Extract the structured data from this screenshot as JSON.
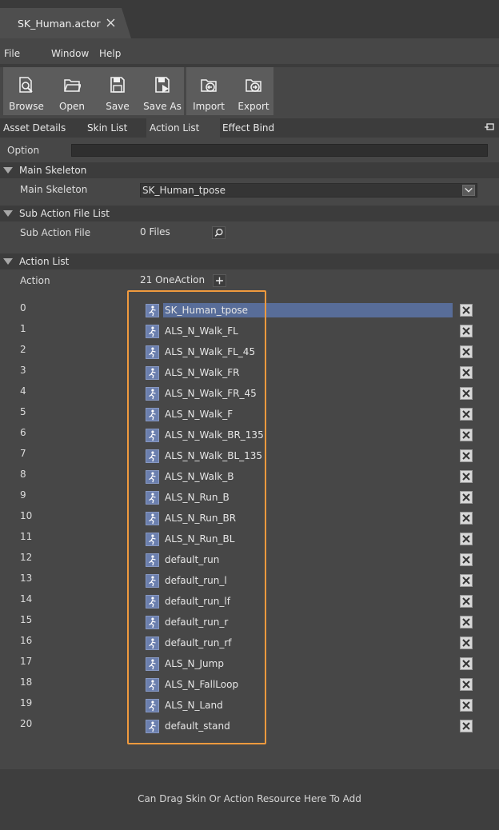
{
  "window": {
    "doc_tab_title": "SK_Human.actor"
  },
  "menu": {
    "items": [
      "File",
      "Window",
      "Help"
    ]
  },
  "toolbar": {
    "group1": [
      {
        "label": "Browse",
        "icon": "browse-icon"
      },
      {
        "label": "Open",
        "icon": "open-folder-icon"
      },
      {
        "label": "Save",
        "icon": "save-icon"
      },
      {
        "label": "Save As",
        "icon": "save-as-icon"
      }
    ],
    "group2": [
      {
        "label": "Import",
        "icon": "import-icon"
      },
      {
        "label": "Export",
        "icon": "export-icon"
      }
    ]
  },
  "tabs": {
    "items": [
      "Asset Details",
      "Skin List",
      "Action List",
      "Effect Bind"
    ],
    "active": "Action List"
  },
  "option": {
    "label": "Option",
    "value": ""
  },
  "main_skeleton": {
    "section_title": "Main Skeleton",
    "label": "Main Skeleton",
    "value": "SK_Human_tpose"
  },
  "sub_action": {
    "section_title": "Sub Action File List",
    "label": "Sub Action File",
    "value": "0 Files"
  },
  "action_list": {
    "section_title": "Action List",
    "label": "Action",
    "count_text": "21 OneAction",
    "selected_index": 0,
    "items": [
      {
        "index": "0",
        "name": "SK_Human_tpose"
      },
      {
        "index": "1",
        "name": "ALS_N_Walk_FL"
      },
      {
        "index": "2",
        "name": "ALS_N_Walk_FL_45"
      },
      {
        "index": "3",
        "name": "ALS_N_Walk_FR"
      },
      {
        "index": "4",
        "name": "ALS_N_Walk_FR_45"
      },
      {
        "index": "5",
        "name": "ALS_N_Walk_F"
      },
      {
        "index": "6",
        "name": "ALS_N_Walk_BR_135"
      },
      {
        "index": "7",
        "name": "ALS_N_Walk_BL_135"
      },
      {
        "index": "8",
        "name": "ALS_N_Walk_B"
      },
      {
        "index": "9",
        "name": "ALS_N_Run_B"
      },
      {
        "index": "10",
        "name": "ALS_N_Run_BR"
      },
      {
        "index": "11",
        "name": "ALS_N_Run_BL"
      },
      {
        "index": "12",
        "name": "default_run"
      },
      {
        "index": "13",
        "name": "default_run_l"
      },
      {
        "index": "14",
        "name": "default_run_lf"
      },
      {
        "index": "15",
        "name": "default_run_r"
      },
      {
        "index": "16",
        "name": "default_run_rf"
      },
      {
        "index": "17",
        "name": "ALS_N_Jump"
      },
      {
        "index": "18",
        "name": "ALS_N_FallLoop"
      },
      {
        "index": "19",
        "name": "ALS_N_Land"
      },
      {
        "index": "20",
        "name": "default_stand"
      }
    ]
  },
  "footer": {
    "hint": "Can Drag Skin Or Action Resource Here To Add"
  },
  "colors": {
    "highlight": "#f09a3e",
    "selection": "#586d99"
  }
}
